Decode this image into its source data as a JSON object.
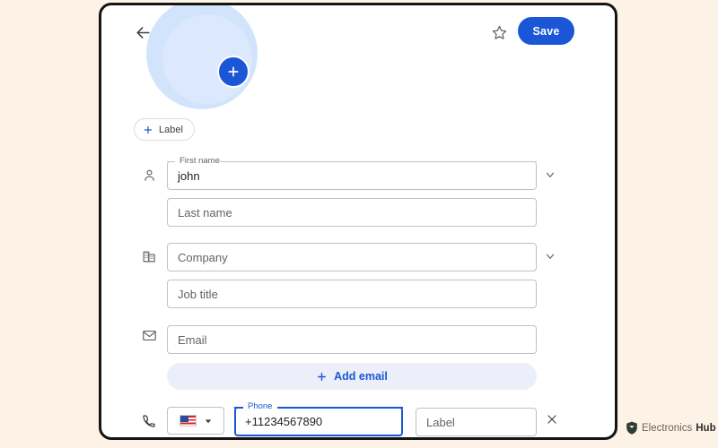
{
  "header": {
    "back_icon": "back-arrow-icon",
    "star_icon": "star-outline-icon",
    "save_label": "Save"
  },
  "avatar": {
    "add_photo_icon": "plus-icon"
  },
  "label_chip": {
    "plus_icon": "plus-icon",
    "label": "Label"
  },
  "form": {
    "name_row": {
      "icon": "person-icon",
      "chevron_icon": "chevron-down-icon",
      "first_name": {
        "label": "First name",
        "value": "john"
      },
      "last_name": {
        "placeholder": "Last name",
        "value": ""
      }
    },
    "company_row": {
      "icon": "building-icon",
      "chevron_icon": "chevron-down-icon",
      "company": {
        "placeholder": "Company",
        "value": ""
      },
      "job_title": {
        "placeholder": "Job title",
        "value": ""
      }
    },
    "email_row": {
      "icon": "envelope-icon",
      "email": {
        "placeholder": "Email",
        "value": ""
      },
      "add_email": {
        "plus_icon": "plus-icon",
        "label": "Add email"
      }
    },
    "phone_row": {
      "icon": "phone-icon",
      "country_select": {
        "flag": "us-flag-icon",
        "caret_icon": "caret-down-icon"
      },
      "phone": {
        "label": "Phone",
        "value": "+11234567890",
        "focused": true
      },
      "phone_label_field": {
        "placeholder": "Label",
        "value": ""
      },
      "remove_icon": "close-icon"
    }
  },
  "watermark": {
    "logo_icon": "shield-logo-icon",
    "text_light": "Electronics",
    "text_bold": "Hub"
  },
  "colors": {
    "page_background": "#fdf2e6",
    "card_background": "#ffffff",
    "card_border": "#141414",
    "accent_blue": "#1a56d6",
    "avatar_blue": "#d2e3fc",
    "add_email_background": "#eceff9",
    "field_border": "#bdc1c6",
    "text_primary": "#202124",
    "text_secondary": "#5f6368"
  }
}
